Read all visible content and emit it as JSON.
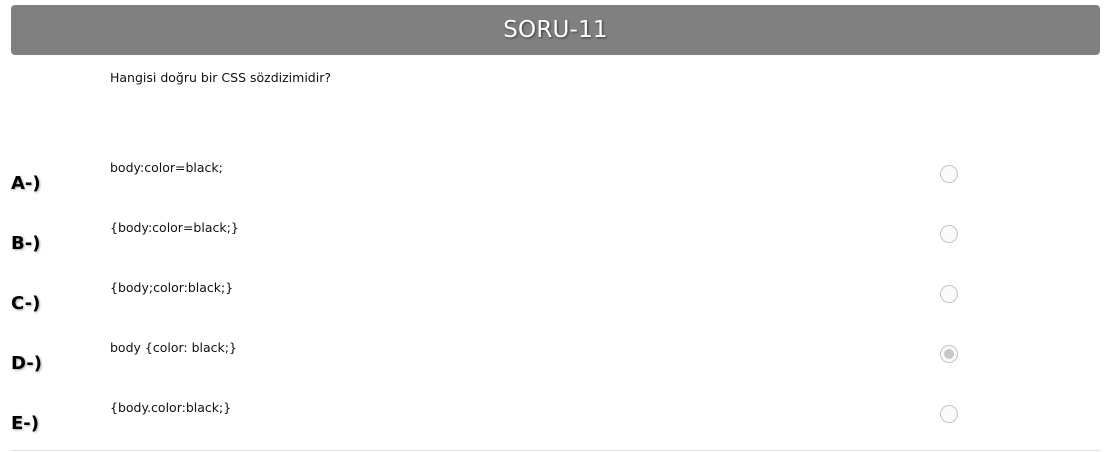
{
  "header": {
    "title": "SORU-11"
  },
  "question": {
    "text": "Hangisi doğru bir CSS sözdizimidir?"
  },
  "options": [
    {
      "letter": "A-)",
      "text": "body:color=black;",
      "selected": false
    },
    {
      "letter": "B-)",
      "text": "{body:color=black;}",
      "selected": false
    },
    {
      "letter": "C-)",
      "text": "{body;color:black;}",
      "selected": false
    },
    {
      "letter": "D-)",
      "text": "body {color: black;}",
      "selected": true
    },
    {
      "letter": "E-)",
      "text": "{body.color:black;}",
      "selected": false
    }
  ],
  "colors": {
    "header_bg": "#808080",
    "header_text": "#ffffff"
  }
}
